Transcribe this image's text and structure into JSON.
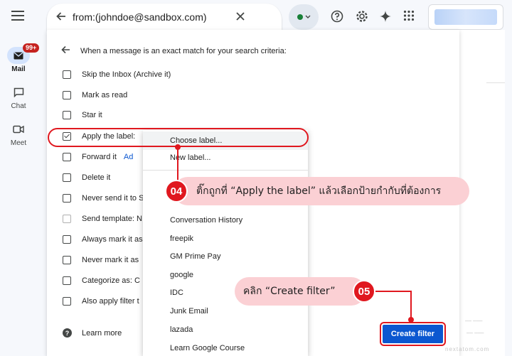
{
  "rail": {
    "mail": {
      "label": "Mail",
      "badge": "99+"
    },
    "chat": {
      "label": "Chat"
    },
    "meet": {
      "label": "Meet"
    }
  },
  "search": {
    "query": "from:(johndoe@sandbox.com)"
  },
  "dialog": {
    "heading": "When a message is an exact match for your search criteria:",
    "options": [
      {
        "label": "Skip the Inbox (Archive it)",
        "checked": false
      },
      {
        "label": "Mark as read",
        "checked": false
      },
      {
        "label": "Star it",
        "checked": false
      },
      {
        "label": "Apply the label:",
        "checked": true
      },
      {
        "label": "Forward it",
        "checked": false,
        "link": "Ad"
      },
      {
        "label": "Delete it",
        "checked": false
      },
      {
        "label": "Never send it to S",
        "checked": false
      },
      {
        "label": "Send template:  N",
        "checked": false,
        "disabled": true
      },
      {
        "label": "Always mark it as",
        "checked": false
      },
      {
        "label": "Never mark it as",
        "checked": false
      },
      {
        "label": "Categorize as:  C",
        "checked": false
      },
      {
        "label": "Also apply filter t",
        "checked": false
      }
    ],
    "learn_more": "Learn more",
    "create_filter": "Create filter"
  },
  "label_menu": {
    "choose": "Choose label...",
    "new": "New label...",
    "labels": [
      "Conversation History",
      "freepik",
      "GM Prime Pay",
      "google",
      "IDC",
      "Junk Email",
      "lazada",
      "Learn Google Course"
    ]
  },
  "annotations": {
    "step4": {
      "number": "04",
      "text": "ติ๊กถูกที่ “Apply the label”  แล้วเลือกป้ายกำกับที่ต้องการ"
    },
    "step5": {
      "number": "05",
      "text": "คลิก “Create filter”"
    }
  },
  "watermark": "nextatom.com",
  "colors": {
    "accent": "#0b57d0",
    "annotation_red": "#e0181f",
    "callout_pink": "#fbd0d4"
  }
}
